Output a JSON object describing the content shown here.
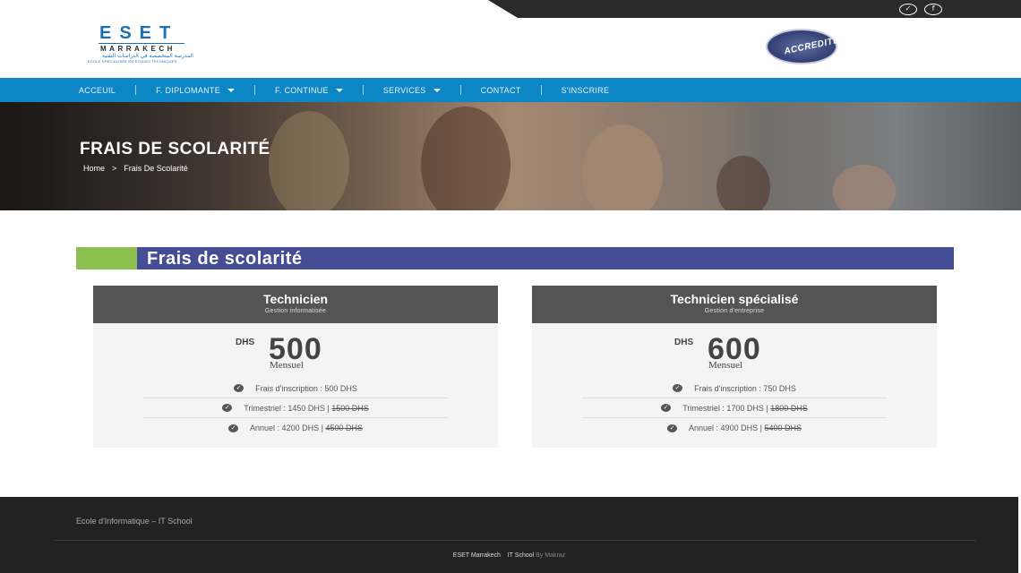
{
  "social": {
    "twitter_icon": "twitter-icon",
    "facebook_icon": "facebook-icon"
  },
  "logo": {
    "main": "ESET",
    "city": "MARRAKECH",
    "arabic": "المدرسة المتخصصة في الدراسات التقنية",
    "tagline": "ECOLE SPECIALISEE EN ETUDES TECHNIQUES"
  },
  "badge": {
    "text": "ACCREDITE"
  },
  "nav": {
    "items": [
      "ACCEUIL",
      "F. DIPLOMANTE",
      "F. CONTINUE",
      "SERVICES",
      "CONTACT",
      "S'INSCRIRE"
    ]
  },
  "hero": {
    "title": "FRAIS DE SCOLARITÉ",
    "breadcrumb_home": "Home",
    "breadcrumb_sep": ">",
    "breadcrumb_current": "Frais De Scolarité"
  },
  "section": {
    "title": "Frais de scolarité"
  },
  "plans": [
    {
      "name": "Technicien",
      "subtitle": "Gestion informatisée",
      "currency": "DHS",
      "amount": "500",
      "period": "Mensuel",
      "features": [
        {
          "text": "Frais d'inscription : 500 DHS",
          "old": ""
        },
        {
          "text": "Trimestriel : 1450 DHS |",
          "old": "1500 DHS"
        },
        {
          "text": "Annuel : 4200 DHS |",
          "old": "4500 DHS"
        }
      ]
    },
    {
      "name": "Technicien spécialisé",
      "subtitle": "Gestion d'entreprise",
      "currency": "DHS",
      "amount": "600",
      "period": "Mensuel",
      "features": [
        {
          "text": "Frais d'inscription : 750 DHS",
          "old": ""
        },
        {
          "text": "Trimestriel : 1700 DHS |",
          "old": "1800 DHS"
        },
        {
          "text": "Annuel : 4900 DHS |",
          "old": "5400 DHS"
        }
      ]
    }
  ],
  "footer": {
    "tagline": "Ecole d'Informatique – IT School",
    "credit_site": "ESET Marrakech",
    "credit_school": "IT School",
    "credit_by": "By Makraz"
  },
  "colors": {
    "nav": "#0d86c6",
    "section_head": "#454d94",
    "accent_green": "#8cc152",
    "card_head": "#545454",
    "footer": "#222222"
  }
}
